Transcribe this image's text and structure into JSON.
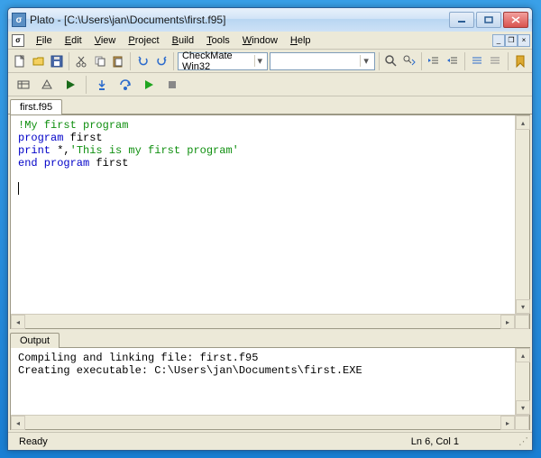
{
  "title": "Plato - [C:\\Users\\jan\\Documents\\first.f95]",
  "menus": {
    "file": "File",
    "edit": "Edit",
    "view": "View",
    "project": "Project",
    "build": "Build",
    "tools": "Tools",
    "window": "Window",
    "help": "Help"
  },
  "combo_build": "CheckMate Win32",
  "combo_target": "",
  "tabs": {
    "active": "first.f95"
  },
  "code": {
    "l1_comment": "!My first program",
    "l2_kw": "program",
    "l2_id": " first",
    "l3_kw": "print",
    "l3_mid": " *,",
    "l3_str": "'This is my first program'",
    "l4_kw": "end program",
    "l4_id": " first"
  },
  "output": {
    "tab": "Output",
    "line1": "Compiling and linking file: first.f95",
    "line2": "Creating executable: C:\\Users\\jan\\Documents\\first.EXE"
  },
  "status": {
    "ready": "Ready",
    "pos": "Ln 6, Col 1"
  }
}
